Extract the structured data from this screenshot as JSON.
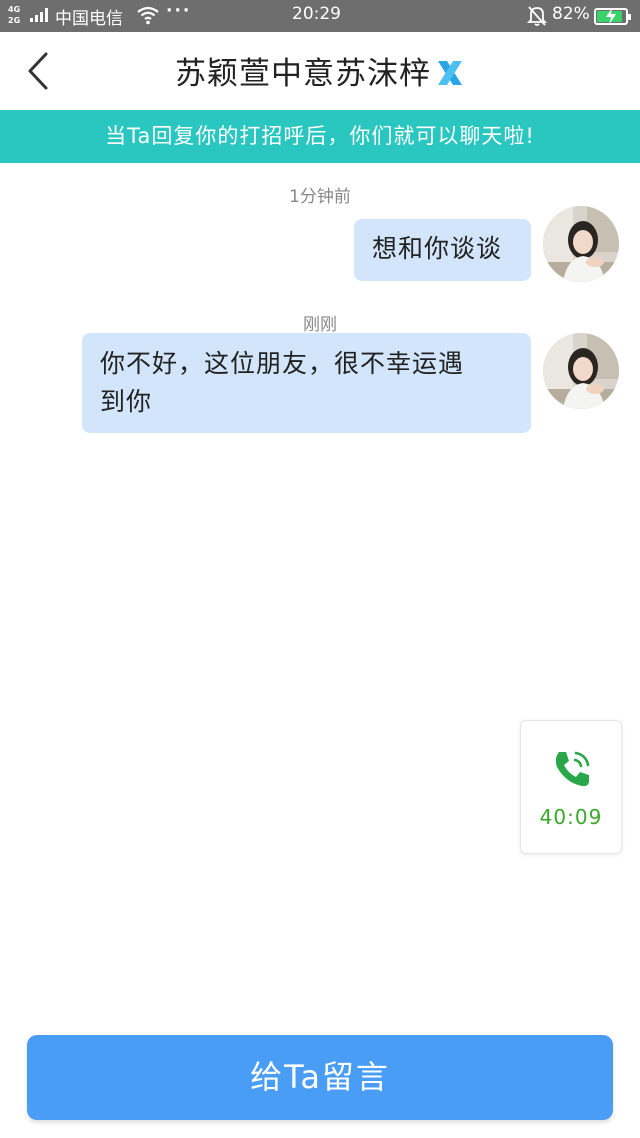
{
  "status_bar": {
    "network_top": "4G",
    "network_bottom": "2G",
    "carrier": "中国电信",
    "more": "···",
    "time": "20:29",
    "battery_percent": "82%",
    "battery_level": 0.82,
    "icons": [
      "signal-icon",
      "wifi-icon",
      "mute-bell-icon",
      "battery-charging-icon"
    ]
  },
  "header": {
    "back_icon": "chevron-left-icon",
    "title": "苏颖萱中意苏沫梓",
    "badge_icon": "x-brand-icon",
    "badge_color": "#2aa6e8"
  },
  "banner": {
    "text": "当Ta回复你的打招呼后，你们就可以聊天啦!",
    "background": "#2ac6c0"
  },
  "messages": [
    {
      "time": "1分钟前",
      "text": "想和你谈谈",
      "sender": "me"
    },
    {
      "time": "刚刚",
      "lines": [
        "你不好，这位朋友，很不幸运遇",
        "到你"
      ],
      "sender": "me"
    }
  ],
  "call_card": {
    "icon": "phone-call-icon",
    "duration": "40:09",
    "color": "#3aa82c"
  },
  "bottom_button": {
    "label": "给Ta留言",
    "background": "#4a9df5"
  }
}
